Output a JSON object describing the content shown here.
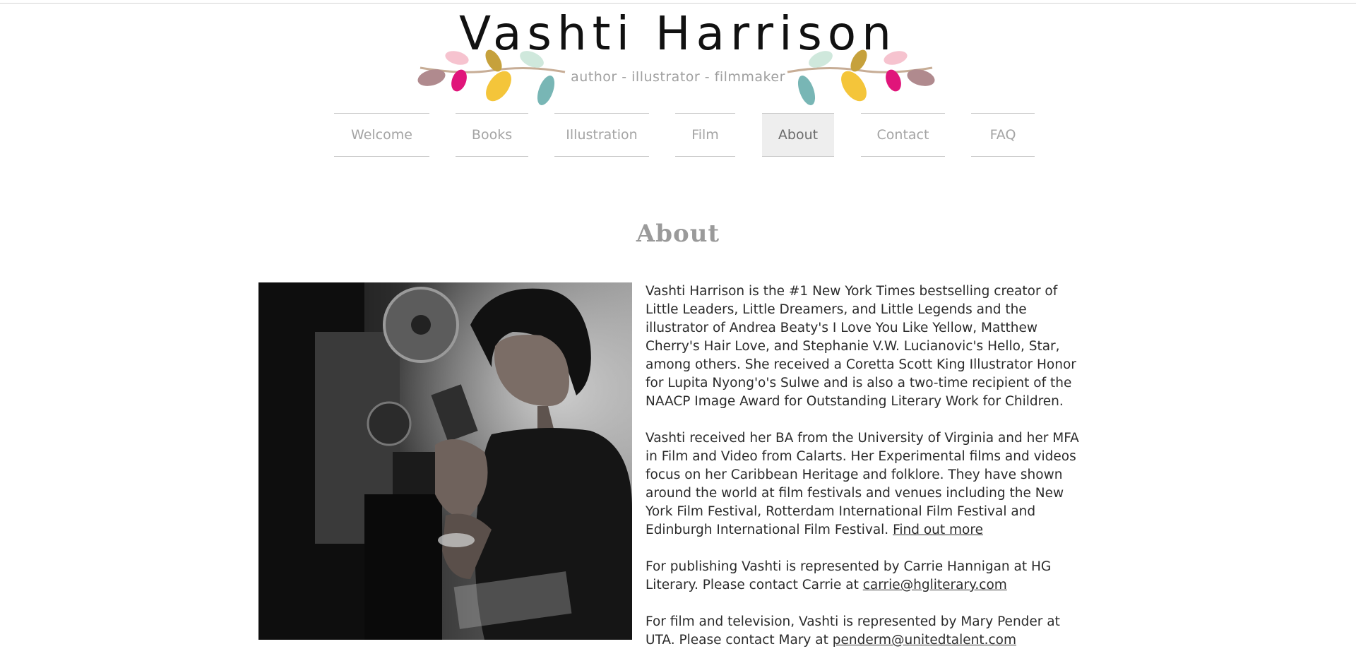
{
  "header": {
    "site_title": "Vashti Harrison",
    "tagline": "author - illustrator - filmmaker"
  },
  "nav": {
    "items": [
      {
        "label": "Welcome"
      },
      {
        "label": "Books"
      },
      {
        "label": "Illustration"
      },
      {
        "label": "Film"
      },
      {
        "label": "About",
        "active": true
      },
      {
        "label": "Contact"
      },
      {
        "label": "FAQ"
      }
    ]
  },
  "main": {
    "heading": "About",
    "bio": {
      "paragraph_1": "Vashti Harrison is the #1 New York Times bestselling creator of Little Leaders, Little Dreamers, and Little Legends and the illustrator of Andrea Beaty's I Love You Like Yellow, Matthew Cherry's Hair Love, and Stephanie V.W. Lucianovic's Hello, Star, among others. She received a Coretta Scott King Illustrator Honor for Lupita Nyong'o's Sulwe and is also a two-time recipient of the NAACP Image Award for Outstanding Literary Work for Children.",
      "paragraph_2": "Vashti received her BA from the University of Virginia and her MFA in Film and Video from Calarts. Her Experimental films and videos focus on her Caribbean Heritage and folklore. They have shown around the world at film festivals and venues including the New York Film Festival, Rotterdam International Film Festival and Edinburgh International Film Festival. ",
      "find_out_more_link": "Find out more ",
      "paragraph_3": "For publishing Vashti is represented by Carrie Hannigan at HG Literary. Please contact Carrie at ",
      "carrie_email": "carrie@hgliterary.com",
      "paragraph_4": "For film and television, Vashti is represented by Mary Pender at UTA. Please contact Mary at ",
      "mary_email": "penderm@unitedtalent.com"
    }
  },
  "colors": {
    "leaf_mauve": "#b08a8e",
    "leaf_magenta": "#e0157a",
    "leaf_yellow": "#f4c53a",
    "leaf_mint": "#cfe8dc",
    "leaf_teal": "#78b6b5",
    "leaf_pink": "#f6c3cf",
    "leaf_olive": "#c6a13c",
    "branch": "#c7ad96"
  }
}
